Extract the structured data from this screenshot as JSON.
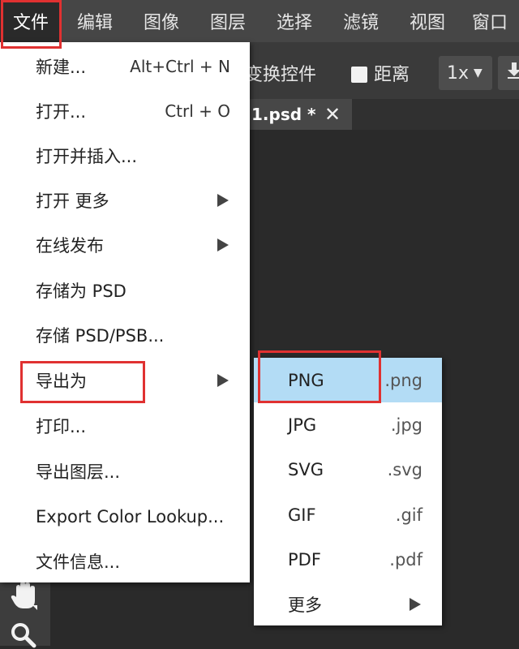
{
  "menubar": {
    "items": [
      "文件",
      "编辑",
      "图像",
      "图层",
      "选择",
      "滤镜",
      "视图",
      "窗口"
    ]
  },
  "options_bar": {
    "transform_controls": "变换控件",
    "distance": "距离",
    "zoom": "1x"
  },
  "document_tab": {
    "title": "1.psd *",
    "close": "✕"
  },
  "file_menu": {
    "items": [
      {
        "label": "新建...",
        "shortcut": "Alt+Ctrl + N"
      },
      {
        "label": "打开...",
        "shortcut": "Ctrl + O"
      },
      {
        "label": "打开并插入...",
        "shortcut": ""
      },
      {
        "label": "打开 更多",
        "shortcut": ""
      },
      {
        "label": "在线发布",
        "shortcut": ""
      },
      {
        "label": "存储为 PSD",
        "shortcut": ""
      },
      {
        "label": "存储 PSD/PSB...",
        "shortcut": ""
      },
      {
        "label": "导出为",
        "shortcut": ""
      },
      {
        "label": "打印...",
        "shortcut": ""
      },
      {
        "label": "导出图层...",
        "shortcut": ""
      },
      {
        "label": "Export Color Lookup...",
        "shortcut": ""
      },
      {
        "label": "文件信息...",
        "shortcut": ""
      }
    ]
  },
  "export_submenu": {
    "items": [
      {
        "label": "PNG",
        "ext": ".png"
      },
      {
        "label": "JPG",
        "ext": ".jpg"
      },
      {
        "label": "SVG",
        "ext": ".svg"
      },
      {
        "label": "GIF",
        "ext": ".gif"
      },
      {
        "label": "PDF",
        "ext": ".pdf"
      },
      {
        "label": "更多",
        "ext": ""
      }
    ]
  },
  "colors": {
    "highlight_border": "#e03131",
    "active_item_bg": "#b3dcf5"
  }
}
